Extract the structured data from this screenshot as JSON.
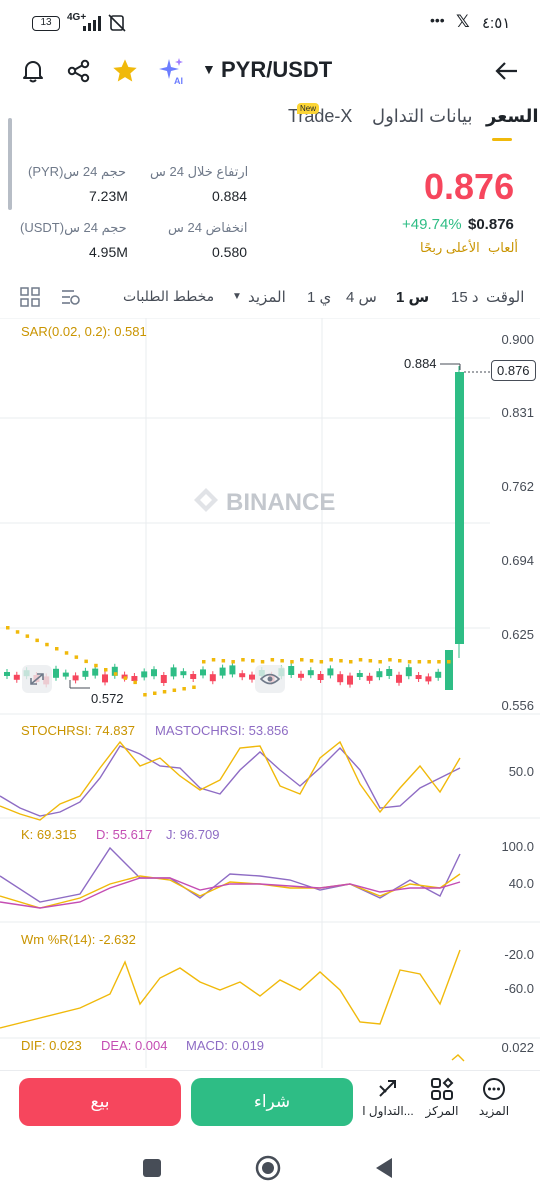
{
  "status_bar": {
    "battery": "13",
    "network": "4G+",
    "time": "٤:٥١",
    "dots": "•••"
  },
  "header": {
    "pair": "PYR/USDT"
  },
  "tabs": [
    {
      "label": "السعر",
      "active": true
    },
    {
      "label": "بيانات التداول",
      "active": false
    },
    {
      "label": "Trade-X",
      "active": false
    }
  ],
  "new_badge": "New",
  "price": {
    "last": "0.876",
    "change": "+49.74%",
    "usd": "$0.876",
    "tag_games": "ألعاب",
    "tag_top_gainer": "الأعلى ربحًا"
  },
  "stats": {
    "high_label": "ارتفاع خلال 24 س",
    "high_value": "0.884",
    "low_label": "انخفاض 24 س",
    "low_value": "0.580",
    "vol_base_label": "حجم 24 س(PYR)",
    "vol_base_value": "7.23M",
    "vol_quote_label": "حجم 24 س(USDT)",
    "vol_quote_value": "4.95M"
  },
  "intervals": {
    "time": "الوقت",
    "m15": "15 د",
    "h1": "1 س",
    "h4": "4 س",
    "d1": "1 ي",
    "more": "المزيد",
    "depth": "مخطط الطلبات"
  },
  "chart": {
    "sar_label": "SAR(0.02, 0.2): 0.581",
    "watermark": "BINANCE",
    "y_axis": [
      "0.900",
      "0.831",
      "0.762",
      "0.694",
      "0.625",
      "0.556"
    ],
    "current_price_tag": "0.876",
    "high_marker": "0.884",
    "low_marker": "0.572",
    "stochrsi_label": "STOCHRSI: 74.837",
    "mastochrsi_label": "MASTOCHRSI: 53.856",
    "stoch_axis": "50.0",
    "k_label": "K: 69.315",
    "d_label": "D: 55.617",
    "j_label": "J: 96.709",
    "kdj_axis": [
      "100.0",
      "40.0"
    ],
    "wr_label": "Wm %R(14): -2.632",
    "wr_axis": [
      "-20.0",
      "-60.0"
    ],
    "dif_label": "DIF: 0.023",
    "dea_label": "DEA: 0.004",
    "macd_label": "MACD: 0.019",
    "macd_axis": "0.022",
    "colors": {
      "up": "#2ebd85",
      "down": "#f6465d",
      "sar": "#f0b90b",
      "purple": "#8e6cc4",
      "magenta": "#c44db3"
    }
  },
  "actions": {
    "sell": "بيع",
    "buy": "شراء",
    "trade": "التداول ا...",
    "center": "المركز",
    "more": "المزيد"
  }
}
